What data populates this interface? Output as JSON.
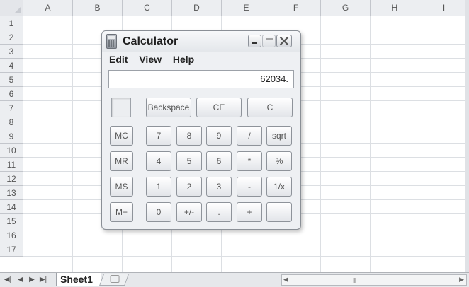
{
  "spreadsheet": {
    "columns": [
      "A",
      "B",
      "C",
      "D",
      "E",
      "F",
      "G",
      "H",
      "I"
    ],
    "rows": [
      "1",
      "2",
      "3",
      "4",
      "5",
      "6",
      "7",
      "8",
      "9",
      "10",
      "11",
      "12",
      "13",
      "14",
      "15",
      "16",
      "17"
    ],
    "active_sheet": "Sheet1"
  },
  "calculator": {
    "title": "Calculator",
    "menu": [
      "Edit",
      "View",
      "Help"
    ],
    "display_value": "62034.",
    "top_keys": [
      "Backspace",
      "CE",
      "C"
    ],
    "memory_keys": [
      "MC",
      "MR",
      "MS",
      "M+"
    ],
    "keypad": [
      [
        "7",
        "8",
        "9",
        "/",
        "sqrt"
      ],
      [
        "4",
        "5",
        "6",
        "*",
        "%"
      ],
      [
        "1",
        "2",
        "3",
        "-",
        "1/x"
      ],
      [
        "0",
        "+/-",
        ".",
        "+",
        "="
      ]
    ]
  },
  "icons": {
    "app": "calculator-icon",
    "minimize": "minimize-icon",
    "maximize": "maximize-icon",
    "close": "close-icon"
  },
  "colors": {
    "close_stroke": "#555555"
  }
}
